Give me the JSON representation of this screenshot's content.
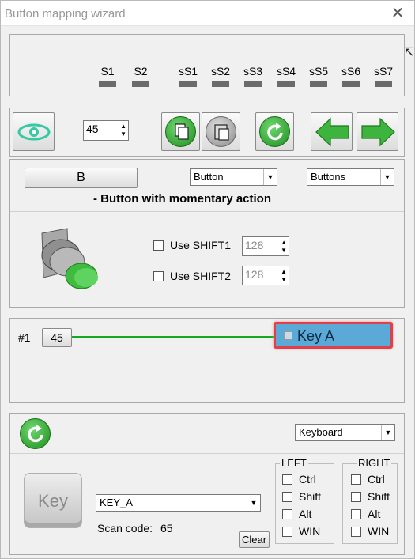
{
  "window": {
    "title": "Button mapping wizard",
    "close_glyph": "✕"
  },
  "shift_indicators": [
    "S1",
    "S2",
    "sS1",
    "sS2",
    "sS3",
    "sS4",
    "sS5",
    "sS6",
    "sS7"
  ],
  "toolbar": {
    "value": "45"
  },
  "button_panel": {
    "button_label": "B",
    "type_select": "Button",
    "category_select": "Buttons",
    "description": "- Button with momentary action",
    "shift1": {
      "label": "Use SHIFT1",
      "value": "128"
    },
    "shift2": {
      "label": "Use SHIFT2",
      "value": "128"
    }
  },
  "mapping": {
    "index_label": "#1",
    "source_value": "45",
    "target_label": "Key A"
  },
  "keyboard": {
    "device_select": "Keyboard",
    "key_icon_label": "Key",
    "key_select": "KEY_A",
    "scan_code_label": "Scan code:",
    "scan_code_value": "65",
    "clear_label": "Clear",
    "left": {
      "title": "LEFT",
      "items": [
        "Ctrl",
        "Shift",
        "Alt",
        "WIN"
      ]
    },
    "right": {
      "title": "RIGHT",
      "items": [
        "Ctrl",
        "Shift",
        "Alt",
        "WIN"
      ]
    }
  },
  "colors": {
    "link_line": "#11aa22",
    "target_bg": "#5aa9d6",
    "target_border": "#e0404a",
    "accent_green": "#2e9e2e"
  }
}
